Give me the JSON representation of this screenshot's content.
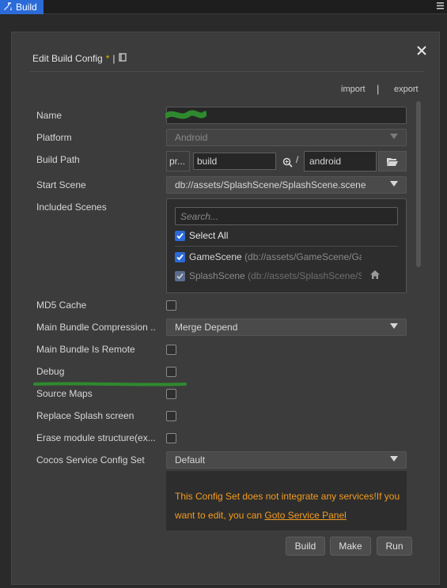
{
  "topbar": {
    "tab_label": "Build",
    "tab_icon": "hammer-wrench-icon",
    "menu_icon": "hamburger-icon"
  },
  "dialog": {
    "title": "Edit Build Config",
    "title_modified": "*",
    "title_separator": "|",
    "title_icon": "book-icon",
    "close_icon": "close-icon",
    "import_label": "import",
    "io_separator": "|",
    "export_label": "export"
  },
  "form": {
    "name": {
      "label": "Name",
      "value": ""
    },
    "platform": {
      "label": "Platform",
      "value": "Android"
    },
    "build_path": {
      "label": "Build Path",
      "prefix": "pr...",
      "value": "build",
      "slash": "/",
      "sub_value": "android"
    },
    "start_scene": {
      "label": "Start Scene",
      "value": "db://assets/SplashScene/SplashScene.scene"
    },
    "included_scenes": {
      "label": "Included Scenes",
      "search_placeholder": "Search...",
      "select_all": "Select All",
      "scenes": [
        {
          "name": "GameScene",
          "path": "(db://assets/GameScene/Gar"
        },
        {
          "name": "SplashScene",
          "path": "(db://assets/SplashScene/Sp"
        }
      ]
    },
    "md5_cache": {
      "label": "MD5 Cache"
    },
    "main_bundle_compression": {
      "label": "Main Bundle Compression ...",
      "value": "Merge Depend"
    },
    "main_bundle_is_remote": {
      "label": "Main Bundle Is Remote"
    },
    "debug": {
      "label": "Debug"
    },
    "source_maps": {
      "label": "Source Maps"
    },
    "replace_splash": {
      "label": "Replace Splash screen"
    },
    "erase_module": {
      "label": "Erase module structure(ex..."
    },
    "cocos_service": {
      "label": "Cocos Service Config Set",
      "value": "Default",
      "warning": "This Config Set does not integrate any services!If you want to edit, you can ",
      "link": "Goto Service Panel"
    }
  },
  "actions": {
    "build": "Build",
    "make": "Make",
    "run": "Run"
  },
  "colors": {
    "accent": "#2b6bd8",
    "warning": "#f49c20",
    "annotation_green": "#2f8a2f"
  }
}
